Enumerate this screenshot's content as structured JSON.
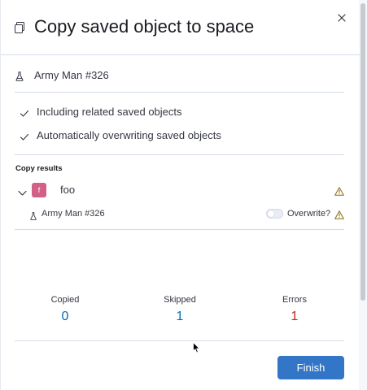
{
  "flyout": {
    "title": "Copy saved object to space"
  },
  "object": {
    "title": "Army Man #326"
  },
  "options": [
    {
      "label": "Including related saved objects"
    },
    {
      "label": "Automatically overwriting saved objects"
    }
  ],
  "results": {
    "title": "Copy results",
    "space": {
      "avatar_initial": "f",
      "avatar_color": "#d36086",
      "name": "foo"
    },
    "item": {
      "title": "Army Man #326",
      "overwrite_label": "Overwrite?",
      "overwrite_enabled": false
    }
  },
  "summary": {
    "copied": {
      "label": "Copied",
      "value": "0",
      "color": "#006bb4"
    },
    "skipped": {
      "label": "Skipped",
      "value": "1",
      "color": "#006bb4"
    },
    "errors": {
      "label": "Errors",
      "value": "1",
      "color": "#bd271e"
    }
  },
  "footer": {
    "finish_label": "Finish"
  },
  "colors": {
    "primary": "#3375c6",
    "warning": "#8a6a0a",
    "text": "#343741",
    "border": "#d3dae6"
  },
  "icons": {
    "header": "copy-icon",
    "object": "beaker-icon",
    "option": "check-icon",
    "expand": "chevron-down-icon",
    "warning": "warning-icon",
    "close": "close-icon"
  }
}
